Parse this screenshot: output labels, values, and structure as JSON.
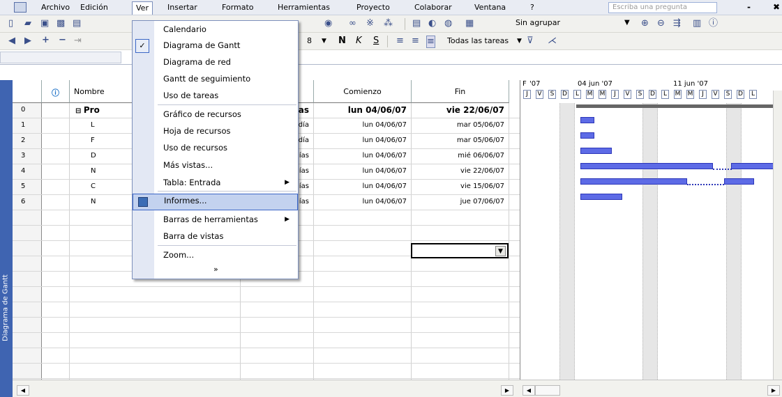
{
  "menubar": {
    "items": [
      "Archivo",
      "Edición",
      "Ver",
      "Insertar",
      "Formato",
      "Herramientas",
      "Proyecto",
      "Colaborar",
      "Ventana",
      "?"
    ],
    "help_placeholder": "Escriba una pregunta",
    "window_controls": [
      "-",
      "✖"
    ]
  },
  "toolbar": {
    "group_dropdown": "Sin agrupar",
    "font_size": "8",
    "bold": "N",
    "italic": "K",
    "underline": "S",
    "filter_dropdown": "Todas las tareas"
  },
  "view_bar": {
    "label": "Diagrama de Gantt",
    "color": "#3f64b1"
  },
  "table": {
    "headers": [
      "",
      "ⓘ",
      "Nombre",
      "",
      "Comienzo",
      "Fin"
    ],
    "rows": [
      {
        "id": "0",
        "name": "Pro",
        "dur": "as",
        "start": "lun 04/06/07",
        "end": "vie 22/06/07",
        "bold": true
      },
      {
        "id": "1",
        "name": "L",
        "dur": "día",
        "start": "lun 04/06/07",
        "end": "mar 05/06/07"
      },
      {
        "id": "2",
        "name": "F",
        "dur": "día",
        "start": "lun 04/06/07",
        "end": "mar 05/06/07"
      },
      {
        "id": "3",
        "name": "D",
        "dur": "ías",
        "start": "lun 04/06/07",
        "end": "mié 06/06/07"
      },
      {
        "id": "4",
        "name": "N",
        "dur": "ías",
        "start": "lun 04/06/07",
        "end": "vie 22/06/07"
      },
      {
        "id": "5",
        "name": "C",
        "dur": "ías",
        "start": "lun 04/06/07",
        "end": "vie 15/06/07"
      },
      {
        "id": "6",
        "name": "N",
        "dur": "ías",
        "start": "lun 04/06/07",
        "end": "jue 07/06/07"
      }
    ]
  },
  "gantt": {
    "week_labels": [
      "F",
      "'07",
      "04 jun '07",
      "11 jun '07"
    ],
    "day_letters": [
      "J",
      "V",
      "S",
      "D",
      "L",
      "M",
      "M",
      "J",
      "V",
      "S",
      "D",
      "L",
      "M",
      "M",
      "J",
      "V",
      "S",
      "D",
      "L"
    ],
    "bar_color": "#5d6be6"
  },
  "dropdown_menu": {
    "items": [
      {
        "label": "Calendario"
      },
      {
        "label": "Diagrama de Gantt",
        "checked": true
      },
      {
        "label": "Diagrama de red"
      },
      {
        "label": "Gantt de seguimiento"
      },
      {
        "label": "Uso de tareas"
      },
      {
        "label": "Gráfico de recursos"
      },
      {
        "label": "Hoja de recursos"
      },
      {
        "label": "Uso de recursos"
      },
      {
        "label": "Más vistas..."
      },
      {
        "label": "Tabla: Entrada",
        "submenu": true
      },
      {
        "label": "Informes...",
        "highlighted": true
      },
      {
        "label": "Barras de herramientas",
        "submenu": true
      },
      {
        "label": "Barra de vistas"
      },
      {
        "label": "Zoom..."
      }
    ],
    "more_glyph": "»"
  }
}
